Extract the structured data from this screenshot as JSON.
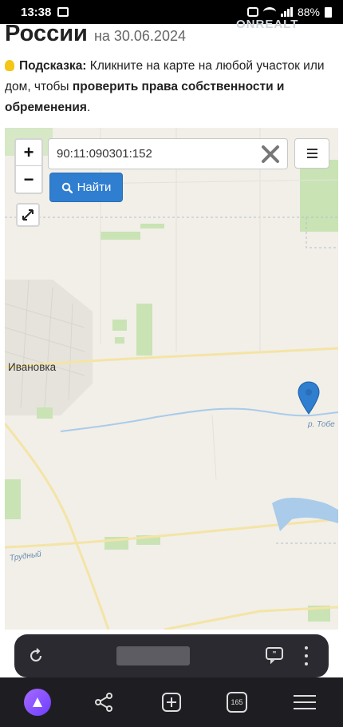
{
  "status_bar": {
    "time": "13:38",
    "battery": "88%"
  },
  "page": {
    "heading": "России",
    "heading_date": "на 30.06.2024",
    "watermark": "ONREALT",
    "hint_label": "Подсказка:",
    "hint_text": " Кликните на карте на любой участок или дом, чтобы ",
    "hint_bold": "проверить права собственности и обременения",
    "hint_end": "."
  },
  "map": {
    "zoom_in": "+",
    "zoom_out": "−",
    "search_value": "90:11:090301:152",
    "find_label": "Найти",
    "town_label": "Ивановка",
    "river_label": "р. Тобе",
    "road_label": "Трудный",
    "marker_color": "#2f7ed0"
  },
  "browser": {
    "tabs_count": "165"
  },
  "colors": {
    "accent": "#2f7ed0",
    "map_bg": "#f1efe8",
    "field_green": "#c9e3b5",
    "road_yellow": "#f4e4a6"
  }
}
